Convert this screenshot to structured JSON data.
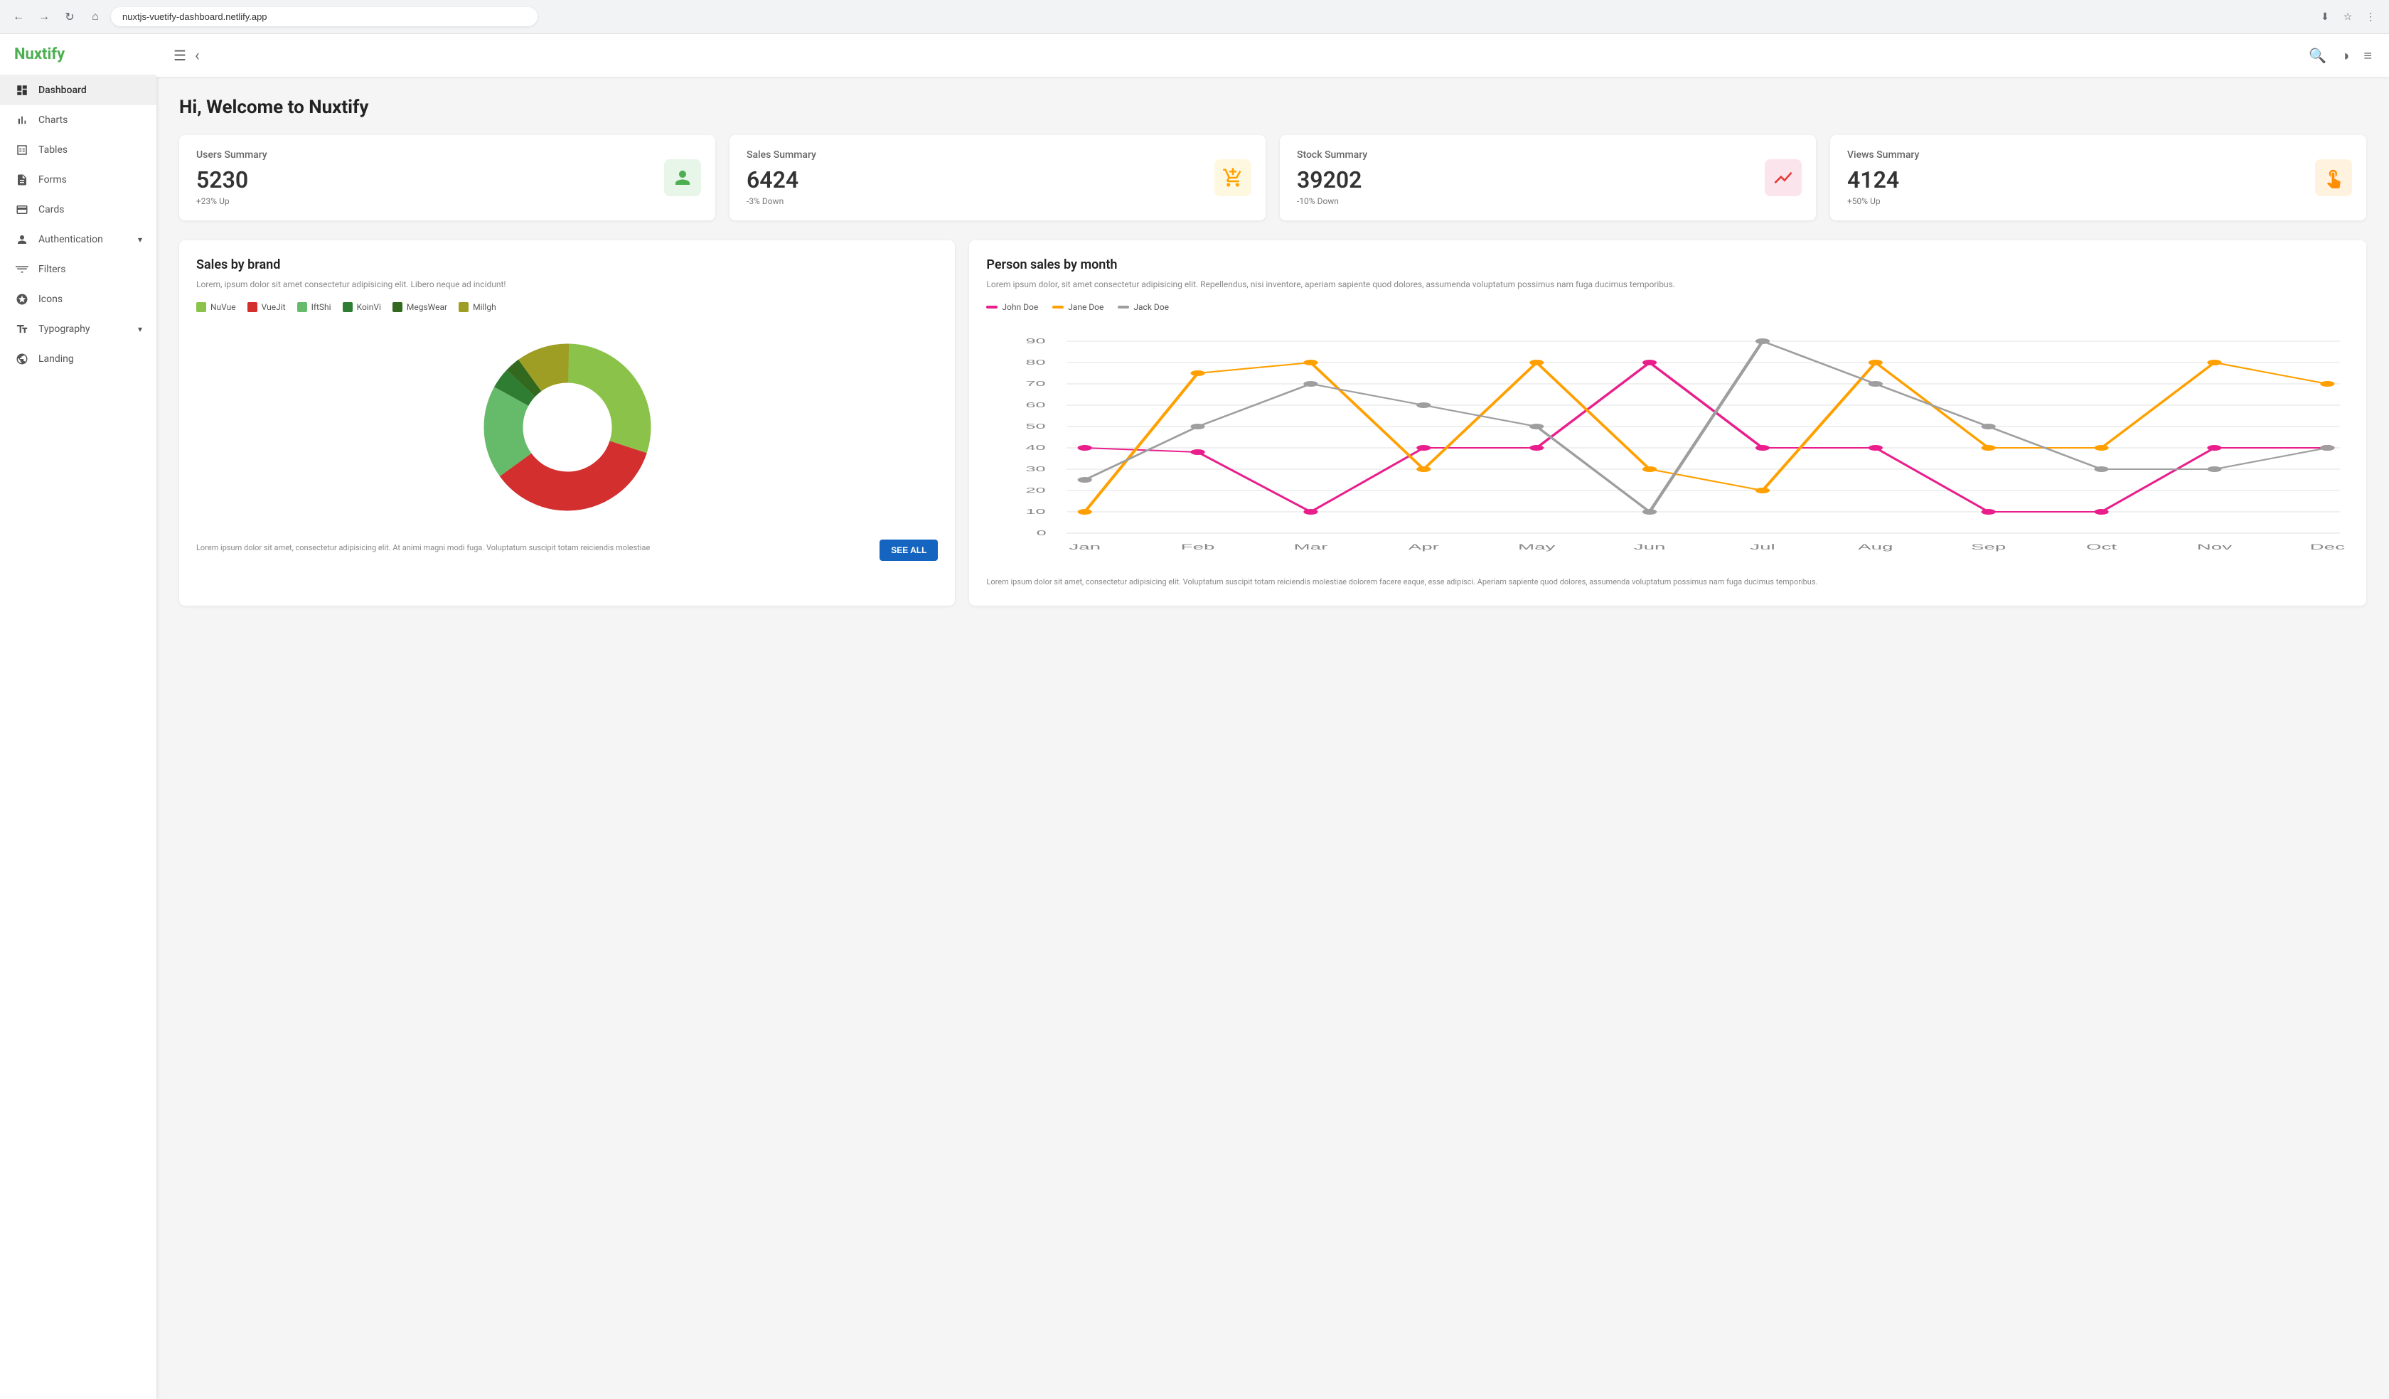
{
  "browser": {
    "url": "nuxtjs-vuetify-dashboard.netlify.app",
    "nav_back": "←",
    "nav_forward": "→",
    "nav_refresh": "↻",
    "nav_home": "⌂"
  },
  "sidebar": {
    "logo": "Nuxtify",
    "items": [
      {
        "id": "dashboard",
        "label": "Dashboard",
        "icon": "grid",
        "active": true,
        "has_chevron": false
      },
      {
        "id": "charts",
        "label": "Charts",
        "icon": "bar_chart",
        "active": false,
        "has_chevron": false
      },
      {
        "id": "tables",
        "label": "Tables",
        "icon": "table_chart",
        "active": false,
        "has_chevron": false
      },
      {
        "id": "forms",
        "label": "Forms",
        "icon": "assignment",
        "active": false,
        "has_chevron": false
      },
      {
        "id": "cards",
        "label": "Cards",
        "icon": "credit_card",
        "active": false,
        "has_chevron": false
      },
      {
        "id": "authentication",
        "label": "Authentication",
        "icon": "person",
        "active": false,
        "has_chevron": true
      },
      {
        "id": "filters",
        "label": "Filters",
        "icon": "filter_list",
        "active": false,
        "has_chevron": false
      },
      {
        "id": "icons",
        "label": "Icons",
        "icon": "star",
        "active": false,
        "has_chevron": false
      },
      {
        "id": "typography",
        "label": "Typography",
        "icon": "notes",
        "active": false,
        "has_chevron": true
      },
      {
        "id": "landing",
        "label": "Landing",
        "icon": "web",
        "active": false,
        "has_chevron": false
      }
    ]
  },
  "topbar": {
    "menu_icon": "☰",
    "back_icon": "‹",
    "search_icon": "🔍",
    "theme_icon": "◑",
    "more_icon": "≡"
  },
  "page": {
    "title": "Hi, Welcome to Nuxtify"
  },
  "summary_cards": [
    {
      "title": "Users Summary",
      "value": "5230",
      "change": "+23% Up",
      "icon_type": "users",
      "icon_symbol": "👤"
    },
    {
      "title": "Sales Summary",
      "value": "6424",
      "change": "-3% Down",
      "icon_type": "sales",
      "icon_symbol": "🛒"
    },
    {
      "title": "Stock Summary",
      "value": "39202",
      "change": "-10% Down",
      "icon_type": "stock",
      "icon_symbol": "📉"
    },
    {
      "title": "Views Summary",
      "value": "4124",
      "change": "+50% Up",
      "icon_type": "views",
      "icon_symbol": "👆"
    }
  ],
  "donut_chart": {
    "title": "Sales by brand",
    "description": "Lorem, ipsum dolor sit amet consectetur adipisicing elit. Libero neque ad incidunt!",
    "legend": [
      {
        "label": "NuVue",
        "color": "#8bc34a"
      },
      {
        "label": "VueJit",
        "color": "#d32f2f"
      },
      {
        "label": "IftShi",
        "color": "#66bb6a"
      },
      {
        "label": "KoinVi",
        "color": "#2e7d32"
      },
      {
        "label": "MegsWear",
        "color": "#33691e"
      },
      {
        "label": "Millgh",
        "color": "#9e9d24"
      }
    ],
    "segments": [
      {
        "color": "#8bc34a",
        "pct": 30
      },
      {
        "color": "#d32f2f",
        "pct": 35
      },
      {
        "color": "#66bb6a",
        "pct": 18
      },
      {
        "color": "#2e7d32",
        "pct": 4
      },
      {
        "color": "#33691e",
        "pct": 3
      },
      {
        "color": "#9e9d24",
        "pct": 10
      }
    ],
    "footer": "Lorem ipsum dolor sit amet, consectetur adipisicing elit. At animi magni modi fuga. Voluptatum suscipit totam reiciendis molestiae",
    "see_all": "SEE ALL"
  },
  "line_chart": {
    "title": "Person sales by month",
    "description": "Lorem ipsum dolor, sit amet consectetur adipisicing elit. Repellendus, nisi inventore, aperiam sapiente quod dolores, assumenda voluptatum possimus nam fuga ducimus temporibus.",
    "legend": [
      {
        "label": "John Doe",
        "color": "#e91e8c"
      },
      {
        "label": "Jane Doe",
        "color": "#ffa000"
      },
      {
        "label": "Jack Doe",
        "color": "#9e9e9e"
      }
    ],
    "y_axis": [
      0,
      10,
      20,
      30,
      40,
      50,
      60,
      70,
      80,
      90
    ],
    "x_axis": [
      "Jan",
      "Feb",
      "Mar",
      "Apr",
      "May",
      "Jun",
      "Jul",
      "Aug",
      "Sep",
      "Oct",
      "Nov",
      "Dec"
    ],
    "series": {
      "john": [
        40,
        38,
        10,
        40,
        40,
        80,
        40,
        40,
        10,
        10,
        40,
        40
      ],
      "jane": [
        10,
        75,
        80,
        30,
        80,
        30,
        20,
        80,
        40,
        40,
        80,
        70
      ],
      "jack": [
        25,
        50,
        70,
        60,
        50,
        10,
        100,
        70,
        50,
        30,
        30,
        40
      ]
    },
    "footer": "Lorem ipsum dolor sit amet, consectetur adipisicing elit. Voluptatum suscipit totam reiciendis molestiae dolorem facere eaque, esse adipisci. Aperiam sapiente quod dolores, assumenda voluptatum possimus nam fuga ducimus temporibus."
  }
}
